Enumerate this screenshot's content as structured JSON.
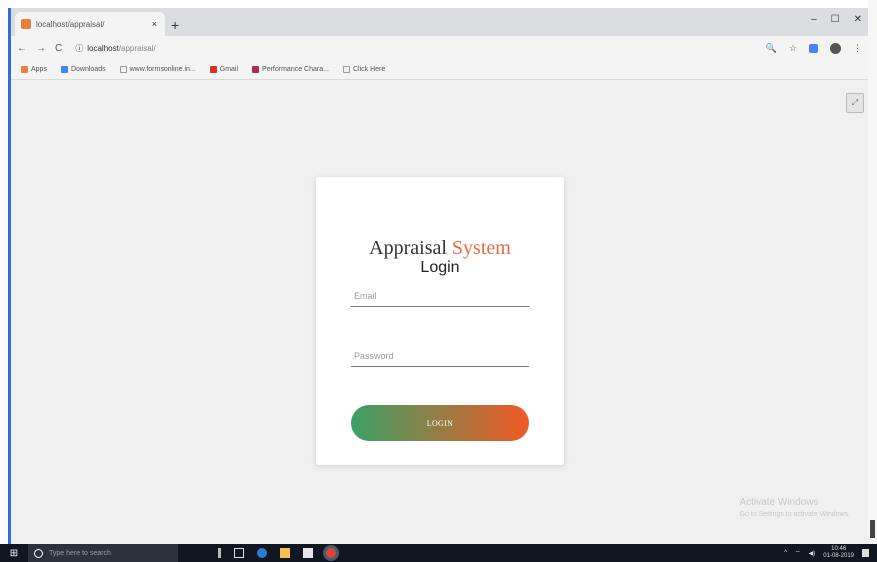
{
  "browser": {
    "tab_title": "localhost/appraisal/",
    "tab_close": "×",
    "new_tab": "+",
    "window_controls": [
      "–",
      "☐",
      "✕"
    ],
    "nav": {
      "back": "←",
      "forward": "→",
      "reload": "C",
      "info": "ⓘ"
    },
    "url_host": "localhost",
    "url_path": "/appraisal/",
    "tools": [
      "🔍",
      "☆"
    ],
    "bookmarks": [
      {
        "label": "Apps",
        "color": "#e8823a"
      },
      {
        "label": "Downloads",
        "color": "#4285f4"
      },
      {
        "label": "www.formsonline.in...",
        "color": "#999999"
      },
      {
        "label": "Gmail",
        "color": "#d93025"
      },
      {
        "label": "Performance Chara...",
        "color": "#a3305c"
      },
      {
        "label": "Click Here",
        "color": "#999999"
      }
    ]
  },
  "login": {
    "title_main": "Appraisal",
    "title_accent": "System",
    "subtitle": "Login",
    "email_placeholder": "Email",
    "password_placeholder": "Password",
    "button_label": "LOGIN",
    "accent_color": "#e86a46",
    "gradient_start": "#3aa066",
    "gradient_end": "#f15a24"
  },
  "watermark": {
    "line1": "Activate Windows",
    "line2": "Go to Settings to activate Windows."
  },
  "taskbar": {
    "search_placeholder": "Type here to search",
    "time": "10:46",
    "date": "01-08-2019"
  }
}
